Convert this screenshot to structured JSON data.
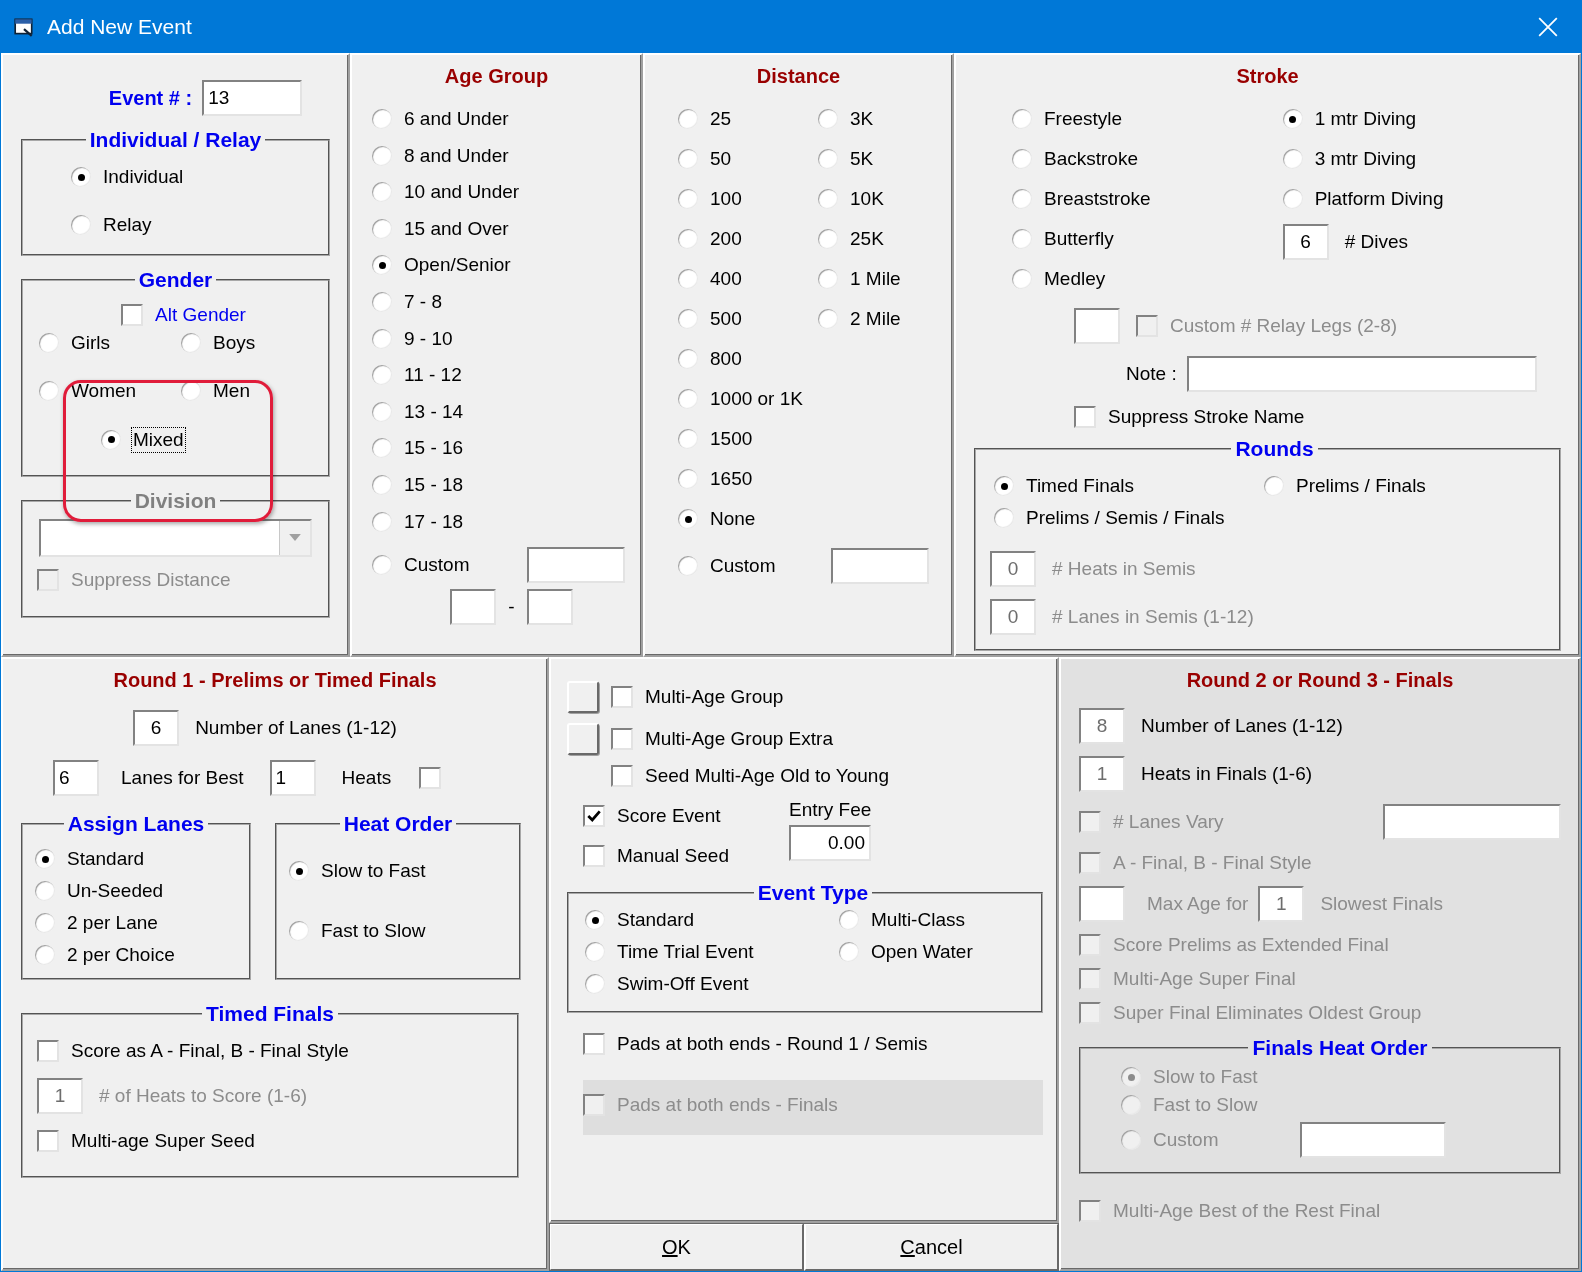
{
  "window": {
    "title": "Add New Event"
  },
  "event_number": {
    "label": "Event # :",
    "value": "13"
  },
  "individual_relay": {
    "title": "Individual / Relay",
    "options": [
      {
        "label": "Individual",
        "selected": true
      },
      {
        "label": "Relay",
        "selected": false
      }
    ]
  },
  "gender": {
    "title": "Gender",
    "alt_gender": {
      "label": "Alt Gender",
      "checked": false
    },
    "options": [
      {
        "label": "Girls",
        "selected": false
      },
      {
        "label": "Boys",
        "selected": false
      },
      {
        "label": "Women",
        "selected": false
      },
      {
        "label": "Men",
        "selected": false
      },
      {
        "label": "Mixed",
        "selected": true,
        "focused": true
      }
    ]
  },
  "division": {
    "title": "Division",
    "disabled": true,
    "suppress_distance": {
      "label": "Suppress Distance",
      "checked": false,
      "disabled": true
    }
  },
  "age_group": {
    "title": "Age Group",
    "options": [
      {
        "label": "6 and Under",
        "selected": false
      },
      {
        "label": "8 and Under",
        "selected": false
      },
      {
        "label": "10 and Under",
        "selected": false
      },
      {
        "label": "15 and Over",
        "selected": false
      },
      {
        "label": "Open/Senior",
        "selected": true
      },
      {
        "label": "7 - 8",
        "selected": false
      },
      {
        "label": "9 - 10",
        "selected": false
      },
      {
        "label": "11 - 12",
        "selected": false
      },
      {
        "label": "13 - 14",
        "selected": false
      },
      {
        "label": "15 - 16",
        "selected": false
      },
      {
        "label": "15 - 18",
        "selected": false
      },
      {
        "label": "17 - 18",
        "selected": false
      },
      {
        "label": "Custom",
        "selected": false
      }
    ],
    "range_separator": "-"
  },
  "distance": {
    "title": "Distance",
    "column_1": [
      {
        "label": "25",
        "selected": false
      },
      {
        "label": "50",
        "selected": false
      },
      {
        "label": "100",
        "selected": false
      },
      {
        "label": "200",
        "selected": false
      },
      {
        "label": "400",
        "selected": false
      },
      {
        "label": "500",
        "selected": false
      },
      {
        "label": "800",
        "selected": false
      },
      {
        "label": "1000 or 1K",
        "selected": false
      },
      {
        "label": "1500",
        "selected": false
      },
      {
        "label": "1650",
        "selected": false
      },
      {
        "label": "None",
        "selected": true
      },
      {
        "label": "Custom",
        "selected": false
      }
    ],
    "column_2": [
      {
        "label": "3K",
        "selected": false
      },
      {
        "label": "5K",
        "selected": false
      },
      {
        "label": "10K",
        "selected": false
      },
      {
        "label": "25K",
        "selected": false
      },
      {
        "label": "1 Mile",
        "selected": false
      },
      {
        "label": "2 Mile",
        "selected": false
      }
    ]
  },
  "stroke": {
    "title": "Stroke",
    "column_1": [
      {
        "label": "Freestyle",
        "selected": false
      },
      {
        "label": "Backstroke",
        "selected": false
      },
      {
        "label": "Breaststroke",
        "selected": false
      },
      {
        "label": "Butterfly",
        "selected": false
      },
      {
        "label": "Medley",
        "selected": false
      }
    ],
    "column_2": [
      {
        "label": "1 mtr Diving",
        "selected": true
      },
      {
        "label": "3 mtr Diving",
        "selected": false
      },
      {
        "label": "Platform Diving",
        "selected": false
      }
    ],
    "dives": {
      "value": "6",
      "label": "# Dives"
    },
    "relay_legs": {
      "label": "Custom # Relay Legs (2-8)",
      "checked": false,
      "disabled": true
    },
    "note": {
      "label": "Note :"
    },
    "suppress_stroke_name": {
      "label": "Suppress Stroke Name",
      "checked": false
    }
  },
  "rounds": {
    "title": "Rounds",
    "options": [
      {
        "label": "Timed Finals",
        "selected": true
      },
      {
        "label": "Prelims / Finals",
        "selected": false
      },
      {
        "label": "Prelims / Semis / Finals",
        "selected": false
      }
    ],
    "fields": [
      {
        "value": "0",
        "label": "# Heats in Semis",
        "disabled": true
      },
      {
        "value": "0",
        "label": "# Lanes in Semis (1-12)",
        "disabled": true
      }
    ]
  },
  "round_1": {
    "title": "Round 1 - Prelims or Timed Finals",
    "lanes": {
      "value": "6",
      "label": "Number of Lanes (1-12)"
    },
    "lanes_for_best": {
      "value": "6",
      "label": "Lanes for Best"
    },
    "heats": {
      "value": "1",
      "label": "Heats",
      "checked": false
    },
    "assign_lanes": {
      "title": "Assign Lanes",
      "options": [
        {
          "label": "Standard",
          "selected": true
        },
        {
          "label": "Un-Seeded",
          "selected": false
        },
        {
          "label": "2 per Lane",
          "selected": false
        },
        {
          "label": "2 per Choice",
          "selected": false
        }
      ]
    },
    "heat_order": {
      "title": "Heat Order",
      "options": [
        {
          "label": "Slow to Fast",
          "selected": true
        },
        {
          "label": "Fast to Slow",
          "selected": false
        }
      ]
    },
    "timed_finals": {
      "title": "Timed Finals",
      "score_as_ab": {
        "label": "Score as A - Final, B - Final Style",
        "checked": false
      },
      "heats_to_score": {
        "value": "1",
        "label": "# of Heats to Score (1-6)",
        "disabled": true
      },
      "super_seed": {
        "label": "Multi-age Super Seed",
        "checked": false
      }
    }
  },
  "options": {
    "multi_age": [
      {
        "label": "Multi-Age Group",
        "checked": false,
        "kind": "with_button"
      },
      {
        "label": "Multi-Age Group Extra",
        "checked": false,
        "kind": "with_button"
      },
      {
        "label": "Seed Multi-Age Old to Young",
        "checked": false,
        "kind": "plain"
      }
    ],
    "score_event": {
      "label": "Score Event",
      "checked": true
    },
    "manual_seed": {
      "label": "Manual Seed",
      "checked": false
    },
    "entry_fee": {
      "label": "Entry Fee",
      "value": "0.00"
    },
    "event_type": {
      "title": "Event Type",
      "options": [
        {
          "label": "Standard",
          "selected": true
        },
        {
          "label": "Multi-Class",
          "selected": false
        },
        {
          "label": "Time Trial Event",
          "selected": false
        },
        {
          "label": "Open Water",
          "selected": false
        },
        {
          "label": "Swim-Off Event",
          "selected": false
        }
      ]
    },
    "pads_round_1": {
      "label": "Pads at both ends - Round 1 / Semis",
      "checked": false,
      "disabled": false
    },
    "pads_finals": {
      "label": "Pads at both ends - Finals",
      "checked": false,
      "disabled": true
    }
  },
  "buttons": [
    {
      "accelerator": "O",
      "rest": "K"
    },
    {
      "accelerator": "C",
      "rest": "ancel"
    }
  ],
  "round_2": {
    "title": "Round 2 or Round 3 - Finals",
    "lanes": {
      "value": "8",
      "label": "Number of Lanes (1-12)"
    },
    "heats": {
      "value": "1",
      "label": "Heats in Finals (1-6)"
    },
    "lanes_vary": {
      "label": "# Lanes Vary",
      "checked": false,
      "disabled": true
    },
    "ab_style": {
      "label": "A - Final, B - Final Style",
      "checked": false,
      "disabled": true
    },
    "max_age": {
      "label": "Max Age for",
      "value": "1",
      "label_2": "Slowest Finals",
      "disabled": true
    },
    "checks": [
      {
        "label": "Score Prelims as Extended Final",
        "checked": false,
        "disabled": true
      },
      {
        "label": "Multi-Age Super Final",
        "checked": false,
        "disabled": true
      },
      {
        "label": "Super Final Eliminates Oldest Group",
        "checked": false,
        "disabled": true
      }
    ],
    "finals_heat_order": {
      "title": "Finals Heat Order",
      "options": [
        {
          "label": "Slow to Fast",
          "selected": true,
          "disabled": true
        },
        {
          "label": "Fast to Slow",
          "selected": false,
          "disabled": true
        },
        {
          "label": "Custom",
          "selected": false,
          "disabled": true
        }
      ]
    },
    "best_of_rest": {
      "label": "Multi-Age Best of the Rest Final",
      "checked": false,
      "disabled": true
    }
  }
}
